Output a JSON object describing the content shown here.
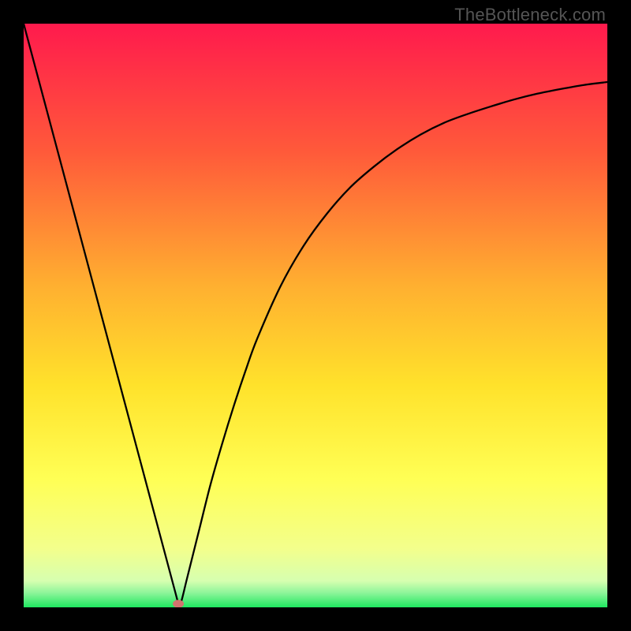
{
  "watermark": "TheBottleneck.com",
  "colors": {
    "background": "#000000",
    "curve": "#000000",
    "marker": "#d2746f",
    "grad_top": "#ff1a4d",
    "grad_upper": "#ff6a33",
    "grad_mid": "#ffcf2b",
    "grad_lower": "#ffff66",
    "grad_pale": "#e6ffb3",
    "grad_green": "#1ee865"
  },
  "chart_data": {
    "type": "line",
    "title": "",
    "xlabel": "",
    "ylabel": "",
    "xlim": [
      0,
      100
    ],
    "ylim": [
      0,
      100
    ],
    "x": [
      0,
      2,
      4,
      6,
      8,
      10,
      12,
      14,
      16,
      18,
      20,
      22,
      24,
      26,
      26.5,
      27,
      28,
      30,
      32,
      34,
      36,
      38,
      40,
      44,
      48,
      52,
      56,
      60,
      64,
      68,
      72,
      76,
      80,
      84,
      88,
      92,
      96,
      100
    ],
    "values": [
      100,
      92.5,
      85,
      77.5,
      70,
      62.5,
      55,
      47.5,
      40,
      32.5,
      25,
      17.5,
      10,
      2.5,
      0.6,
      1.0,
      5,
      13,
      21,
      28,
      34.5,
      40.5,
      46,
      55,
      62,
      67.5,
      72,
      75.5,
      78.5,
      81,
      83,
      84.5,
      85.8,
      87,
      88,
      88.8,
      89.5,
      90
    ],
    "marker": {
      "x": 26.5,
      "y": 0.6
    }
  }
}
